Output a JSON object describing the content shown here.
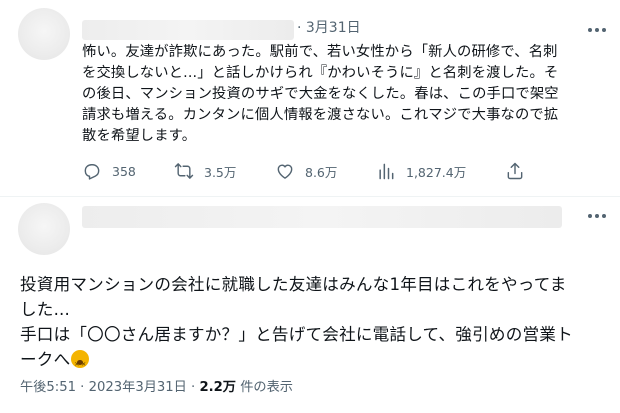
{
  "reply_tweet": {
    "date": "· 3月31日",
    "text_lines": [
      "怖い。友達が詐欺にあった。駅前で、若い女性から「新人の研修で、名刺",
      "を交換しないと...」と話しかけられ『かわいそうに』と名刺を渡した。そ",
      "の後日、マンション投資のサギで大金をなくした。春は、この手口で架空",
      "請求も増える。カンタンに個人情報を渡さない。これマジで大事なので拡",
      "散を希望します。"
    ],
    "actions": {
      "replies": "358",
      "retweets": "3.5万",
      "likes": "8.6万",
      "views": "1,827.4万"
    }
  },
  "main_tweet": {
    "text_lines": [
      "投資用マンションの会社に就職した友達はみんな1年目はこれをやってま",
      "した...",
      "手口は「〇〇さん居ますか？」と告げて会社に電話して、強引めの営業ト",
      "ークへ"
    ],
    "emoji": "dizzy-face",
    "footer": {
      "timestamp": "午後5:51 · 2023年3月31日 · ",
      "views_count": "2.2万",
      "views_label": " 件の表示"
    }
  },
  "colors": {
    "text": "#0f1419",
    "secondary": "#536471",
    "divider": "#eff3f4"
  }
}
